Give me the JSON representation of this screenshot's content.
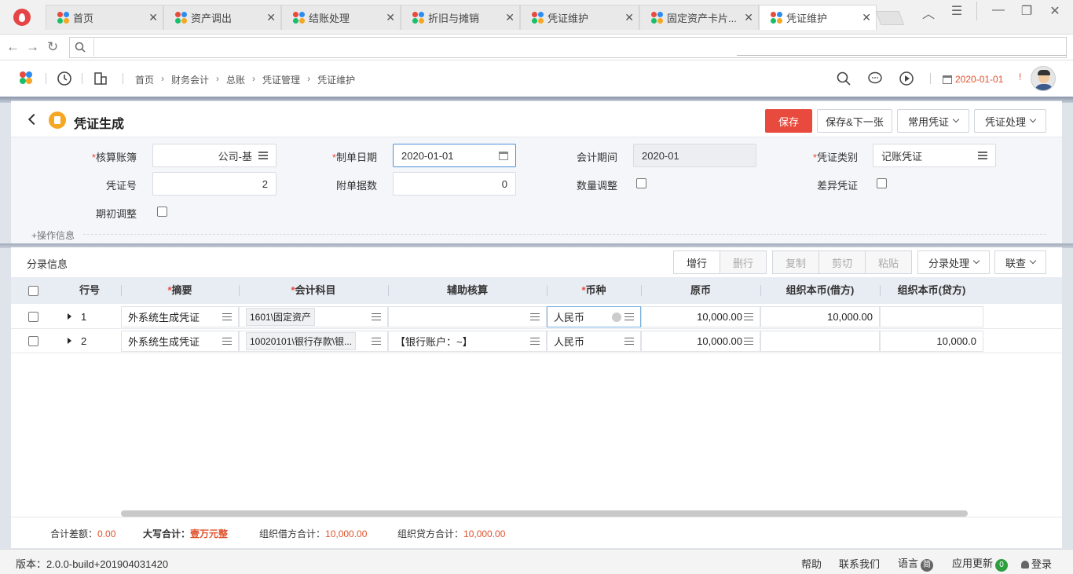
{
  "browser": {
    "tabs": [
      {
        "label": "首页",
        "active": false
      },
      {
        "label": "资产调出",
        "active": false
      },
      {
        "label": "结账处理",
        "active": false
      },
      {
        "label": "折旧与摊销",
        "active": false
      },
      {
        "label": "凭证维护",
        "active": false
      },
      {
        "label": "固定资产卡片...",
        "active": false
      },
      {
        "label": "凭证维护",
        "active": true
      }
    ],
    "address": ""
  },
  "header": {
    "breadcrumb": [
      "首页",
      "财务会计",
      "总账",
      "凭证管理",
      "凭证维护"
    ],
    "date": "2020-01-01",
    "alert": "!"
  },
  "page": {
    "title": "凭证生成",
    "buttons": {
      "save": "保存",
      "save_next": "保存&下一张",
      "common_voucher": "常用凭证",
      "voucher_process": "凭证处理"
    }
  },
  "form": {
    "ledger": {
      "label": "核算账簿",
      "value": "公司-基"
    },
    "make_date": {
      "label": "制单日期",
      "value": "2020-01-01"
    },
    "period": {
      "label": "会计期间",
      "value": "2020-01"
    },
    "voucher_type": {
      "label": "凭证类别",
      "value": "记账凭证"
    },
    "voucher_no": {
      "label": "凭证号",
      "value": "2"
    },
    "attachments": {
      "label": "附单据数",
      "value": "0"
    },
    "qty_adjust": {
      "label": "数量调整"
    },
    "diff_voucher": {
      "label": "差异凭证"
    },
    "opening_adjust": {
      "label": "期初调整"
    },
    "op_info": "+操作信息"
  },
  "entries": {
    "title": "分录信息",
    "buttons": {
      "add_row": "增行",
      "delete_row": "删行",
      "copy": "复制",
      "cut": "剪切",
      "paste": "粘贴",
      "entry_process": "分录处理",
      "link_query": "联查"
    },
    "columns": {
      "row_no": "行号",
      "summary": "摘要",
      "account": "会计科目",
      "aux": "辅助核算",
      "currency": "币种",
      "original": "原币",
      "debit": "组织本币(借方)",
      "credit": "组织本币(贷方)"
    },
    "rows": [
      {
        "no": "1",
        "summary": "外系统生成凭证",
        "account": "1601\\固定资产",
        "aux": "",
        "currency": "人民币",
        "original": "10,000.00",
        "debit": "10,000.00",
        "credit": ""
      },
      {
        "no": "2",
        "summary": "外系统生成凭证",
        "account": "10020101\\银行存款\\银...",
        "aux": "【银行账户：~】",
        "currency": "人民币",
        "original": "10,000.00",
        "debit": "",
        "credit": "10,000.0"
      }
    ],
    "totals": {
      "diff_label": "合计差额：",
      "diff_value": "0.00",
      "caps_label": "大写合计：",
      "caps_value": "壹万元整",
      "debit_label": "组织借方合计：",
      "debit_value": "10,000.00",
      "credit_label": "组织贷方合计：",
      "credit_value": "10,000.00"
    }
  },
  "footer": {
    "version": "版本：2.0.0-build+201904031420",
    "help": "帮助",
    "contact": "联系我们",
    "language": "语言",
    "language_badge": "简",
    "updates": "应用更新",
    "updates_count": "0",
    "login": "登录"
  },
  "colors": {
    "accent": "#e84a3d",
    "link": "#e0522d",
    "header_bg": "#e8ecf3"
  }
}
